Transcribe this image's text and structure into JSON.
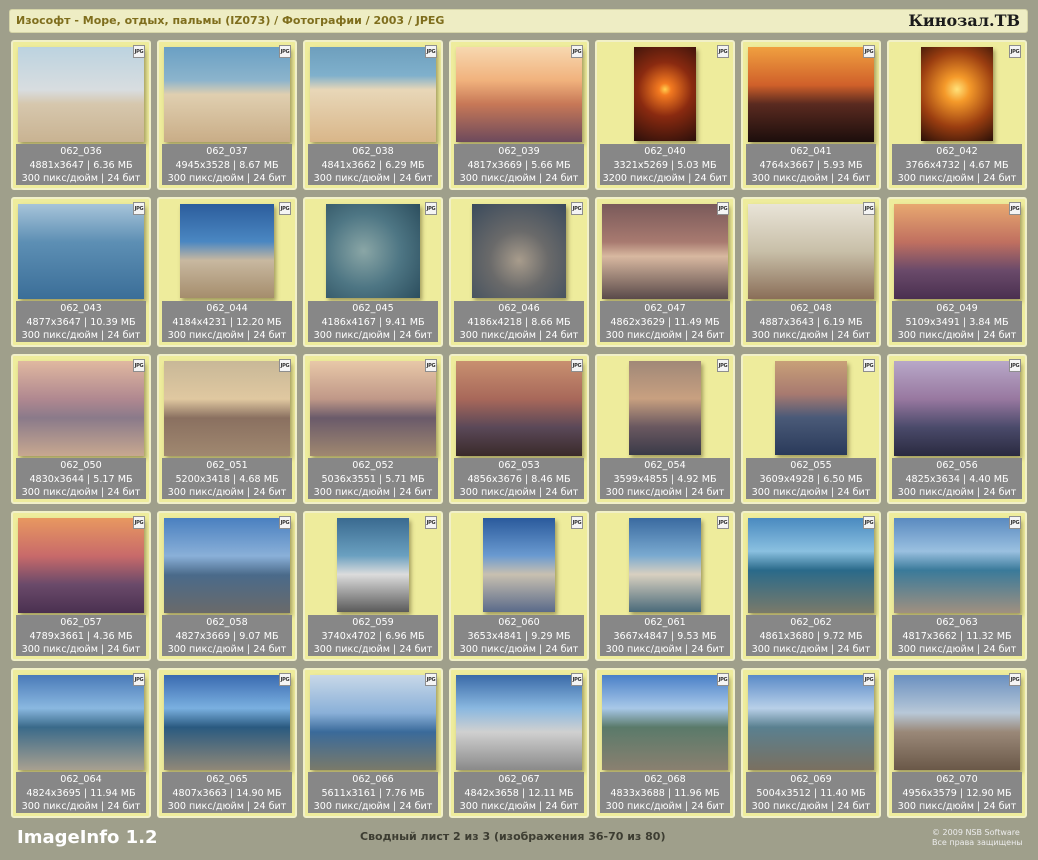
{
  "header": {
    "path": "Изософт - Море, отдых, пальмы (IZ073) / Фотографии / 2003 / JPEG",
    "brand": "Кинозал.ТВ"
  },
  "badge": "JPG",
  "thumbnails": [
    {
      "name": "062_036",
      "info": "4881x3647 | 6.36 МБ",
      "res": "300 пикс/дюйм | 24 бит"
    },
    {
      "name": "062_037",
      "info": "4945x3528 | 8.67 МБ",
      "res": "300 пикс/дюйм | 24 бит"
    },
    {
      "name": "062_038",
      "info": "4841x3662 | 6.29 МБ",
      "res": "300 пикс/дюйм | 24 бит"
    },
    {
      "name": "062_039",
      "info": "4817x3669 | 5.66 МБ",
      "res": "300 пикс/дюйм | 24 бит"
    },
    {
      "name": "062_040",
      "info": "3321x5269 | 5.03 МБ",
      "res": "3200 пикс/дюйм | 24 бит"
    },
    {
      "name": "062_041",
      "info": "4764x3667 | 5.93 МБ",
      "res": "300 пикс/дюйм | 24 бит"
    },
    {
      "name": "062_042",
      "info": "3766x4732 | 4.67 МБ",
      "res": "300 пикс/дюйм | 24 бит"
    },
    {
      "name": "062_043",
      "info": "4877x3647 | 10.39 МБ",
      "res": "300 пикс/дюйм | 24 бит"
    },
    {
      "name": "062_044",
      "info": "4184x4231 | 12.20 МБ",
      "res": "300 пикс/дюйм | 24 бит"
    },
    {
      "name": "062_045",
      "info": "4186x4167 | 9.41 МБ",
      "res": "300 пикс/дюйм | 24 бит"
    },
    {
      "name": "062_046",
      "info": "4186x4218 | 8.66 МБ",
      "res": "300 пикс/дюйм | 24 бит"
    },
    {
      "name": "062_047",
      "info": "4862x3629 | 11.49 МБ",
      "res": "300 пикс/дюйм | 24 бит"
    },
    {
      "name": "062_048",
      "info": "4887x3643 | 6.19 МБ",
      "res": "300 пикс/дюйм | 24 бит"
    },
    {
      "name": "062_049",
      "info": "5109x3491 | 3.84 МБ",
      "res": "300 пикс/дюйм | 24 бит"
    },
    {
      "name": "062_050",
      "info": "4830x3644 | 5.17 МБ",
      "res": "300 пикс/дюйм | 24 бит"
    },
    {
      "name": "062_051",
      "info": "5200x3418 | 4.68 МБ",
      "res": "300 пикс/дюйм | 24 бит"
    },
    {
      "name": "062_052",
      "info": "5036x3551 | 5.71 МБ",
      "res": "300 пикс/дюйм | 24 бит"
    },
    {
      "name": "062_053",
      "info": "4856x3676 | 8.46 МБ",
      "res": "300 пикс/дюйм | 24 бит"
    },
    {
      "name": "062_054",
      "info": "3599x4855 | 4.92 МБ",
      "res": "300 пикс/дюйм | 24 бит"
    },
    {
      "name": "062_055",
      "info": "3609x4928 | 6.50 МБ",
      "res": "300 пикс/дюйм | 24 бит"
    },
    {
      "name": "062_056",
      "info": "4825x3634 | 4.40 МБ",
      "res": "300 пикс/дюйм | 24 бит"
    },
    {
      "name": "062_057",
      "info": "4789x3661 | 4.36 МБ",
      "res": "300 пикс/дюйм | 24 бит"
    },
    {
      "name": "062_058",
      "info": "4827x3669 | 9.07 МБ",
      "res": "300 пикс/дюйм | 24 бит"
    },
    {
      "name": "062_059",
      "info": "3740x4702 | 6.96 МБ",
      "res": "300 пикс/дюйм | 24 бит"
    },
    {
      "name": "062_060",
      "info": "3653x4841 | 9.29 МБ",
      "res": "300 пикс/дюйм | 24 бит"
    },
    {
      "name": "062_061",
      "info": "3667x4847 | 9.53 МБ",
      "res": "300 пикс/дюйм | 24 бит"
    },
    {
      "name": "062_062",
      "info": "4861x3680 | 9.72 МБ",
      "res": "300 пикс/дюйм | 24 бит"
    },
    {
      "name": "062_063",
      "info": "4817x3662 | 11.32 МБ",
      "res": "300 пикс/дюйм | 24 бит"
    },
    {
      "name": "062_064",
      "info": "4824x3695 | 11.94 МБ",
      "res": "300 пикс/дюйм | 24 бит"
    },
    {
      "name": "062_065",
      "info": "4807x3663 | 14.90 МБ",
      "res": "300 пикс/дюйм | 24 бит"
    },
    {
      "name": "062_066",
      "info": "5611x3161 | 7.76 МБ",
      "res": "300 пикс/дюйм | 24 бит"
    },
    {
      "name": "062_067",
      "info": "4842x3658 | 12.11 МБ",
      "res": "300 пикс/дюйм | 24 бит"
    },
    {
      "name": "062_068",
      "info": "4833x3688 | 11.96 МБ",
      "res": "300 пикс/дюйм | 24 бит"
    },
    {
      "name": "062_069",
      "info": "5004x3512 | 11.40 МБ",
      "res": "300 пикс/дюйм | 24 бит"
    },
    {
      "name": "062_070",
      "info": "4956x3579 | 12.90 МБ",
      "res": "300 пикс/дюйм | 24 бит"
    }
  ],
  "footer": {
    "app": "ImageInfo 1.2",
    "summary": "Сводный лист 2 из 3 (изображения 36-70 из 80)",
    "copyright": "© 2009 NSB Software",
    "rights": "Все права защищены"
  }
}
